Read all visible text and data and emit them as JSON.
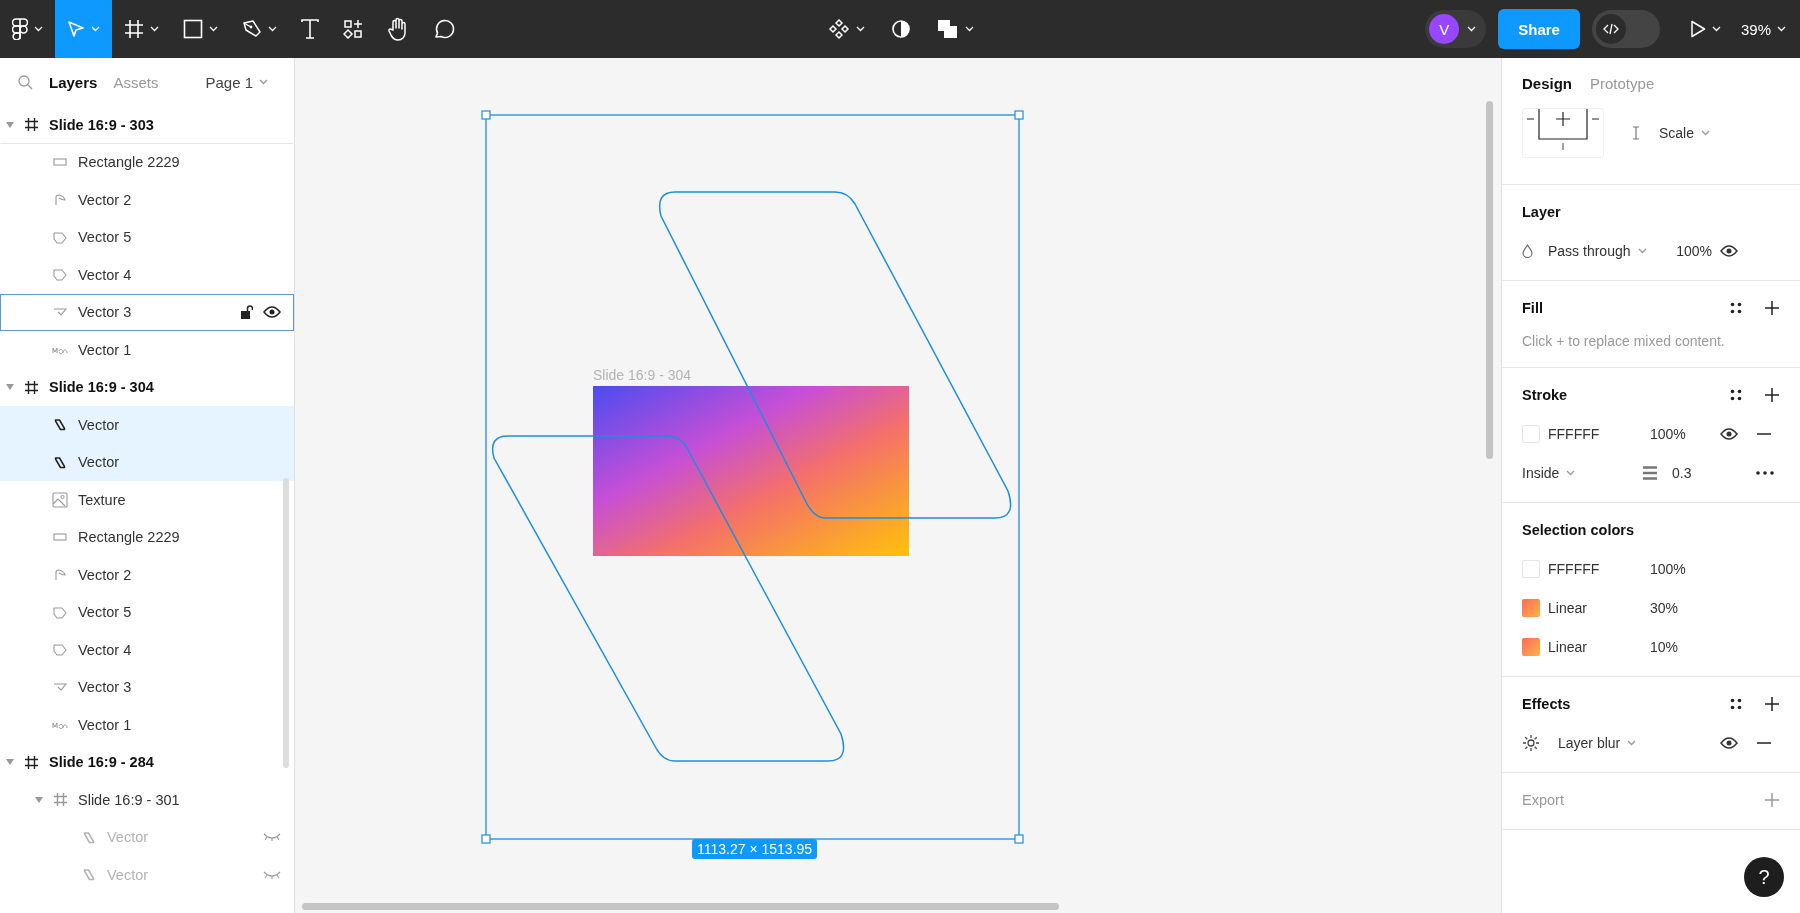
{
  "toolbar": {
    "tools": [
      {
        "kind": "main-menu",
        "selected": false
      },
      {
        "kind": "move",
        "selected": true
      },
      {
        "kind": "frame",
        "selected": false
      },
      {
        "kind": "shape",
        "selected": false
      },
      {
        "kind": "pen",
        "selected": false
      },
      {
        "kind": "text",
        "selected": false
      },
      {
        "kind": "resources",
        "selected": false
      },
      {
        "kind": "hand",
        "selected": false
      },
      {
        "kind": "comment",
        "selected": false
      }
    ],
    "center_tools": [
      {
        "kind": "components"
      },
      {
        "kind": "mask"
      },
      {
        "kind": "boolean"
      }
    ],
    "avatar": "V",
    "share": "Share",
    "dev_mode": {
      "on": false
    },
    "zoom": "39%"
  },
  "layers_panel": {
    "tabs": [
      {
        "label": "Layers",
        "selected": true
      },
      {
        "label": "Assets",
        "selected": false
      }
    ],
    "page": "Page 1",
    "layers": [
      {
        "name": "Slide 16:9 - 303",
        "kind": "frame",
        "expanded": true,
        "selected": false,
        "hovered": false,
        "hidden": false,
        "children": [
          {
            "name": "Rectangle 2229",
            "kind": "rect",
            "selected": false,
            "hovered": false,
            "hidden": false
          },
          {
            "name": "Vector 2",
            "kind": "pen",
            "selected": false,
            "hovered": false,
            "hidden": false
          },
          {
            "name": "Vector 5",
            "kind": "shape",
            "selected": false,
            "hovered": false,
            "hidden": false
          },
          {
            "name": "Vector 4",
            "kind": "shape",
            "selected": false,
            "hovered": false,
            "hidden": false
          },
          {
            "name": "Vector 3",
            "kind": "curve",
            "selected": false,
            "hovered": true,
            "hidden": false
          },
          {
            "name": "Vector 1",
            "kind": "squiggle",
            "selected": false,
            "hovered": false,
            "hidden": false
          }
        ]
      },
      {
        "name": "Slide 16:9 - 304",
        "kind": "frame",
        "expanded": true,
        "selected": false,
        "hovered": false,
        "hidden": false,
        "children": [
          {
            "name": "Vector",
            "kind": "path",
            "selected": true,
            "hovered": false,
            "hidden": false
          },
          {
            "name": "Vector",
            "kind": "path",
            "selected": true,
            "hovered": false,
            "hidden": false
          },
          {
            "name": "Texture",
            "kind": "image",
            "selected": false,
            "hovered": false,
            "hidden": false
          },
          {
            "name": "Rectangle 2229",
            "kind": "rect",
            "selected": false,
            "hovered": false,
            "hidden": false
          },
          {
            "name": "Vector 2",
            "kind": "pen",
            "selected": false,
            "hovered": false,
            "hidden": false
          },
          {
            "name": "Vector 5",
            "kind": "shape",
            "selected": false,
            "hovered": false,
            "hidden": false
          },
          {
            "name": "Vector 4",
            "kind": "shape",
            "selected": false,
            "hovered": false,
            "hidden": false
          },
          {
            "name": "Vector 3",
            "kind": "curve",
            "selected": false,
            "hovered": false,
            "hidden": false
          },
          {
            "name": "Vector 1",
            "kind": "squiggle",
            "selected": false,
            "hovered": false,
            "hidden": false
          }
        ]
      },
      {
        "name": "Slide 16:9 - 284",
        "kind": "frame",
        "expanded": true,
        "selected": false,
        "hovered": false,
        "hidden": false,
        "children": [
          {
            "name": "Slide 16:9 - 301",
            "kind": "frame",
            "expanded": true,
            "selected": false,
            "hovered": false,
            "hidden": false,
            "children": [
              {
                "name": "Vector",
                "kind": "path",
                "selected": false,
                "hovered": false,
                "hidden": true
              },
              {
                "name": "Vector",
                "kind": "path",
                "selected": false,
                "hovered": false,
                "hidden": true
              }
            ]
          }
        ]
      }
    ]
  },
  "canvas": {
    "frame_label": "Slide 16:9 - 304",
    "size_badge": "1113.27 × 1513.95"
  },
  "properties_panel": {
    "tabs": [
      {
        "label": "Design",
        "selected": true
      },
      {
        "label": "Prototype",
        "selected": false
      }
    ],
    "constraints": {
      "vertical": "Scale"
    },
    "layer": {
      "title": "Layer",
      "blend_mode": "Pass through",
      "opacity": "100%",
      "visible": true
    },
    "fill": {
      "title": "Fill",
      "hint": "Click + to replace mixed content."
    },
    "stroke": {
      "title": "Stroke",
      "hex": "FFFFFF",
      "opacity": "100%",
      "visible": true,
      "position": "Inside",
      "weight": "0.3"
    },
    "selection_colors": {
      "title": "Selection colors",
      "items": [
        {
          "kind": "solid",
          "label": "FFFFFF",
          "opacity": "100%"
        },
        {
          "kind": "gradient",
          "label": "Linear",
          "opacity": "30%"
        },
        {
          "kind": "gradient",
          "label": "Linear",
          "opacity": "10%"
        }
      ]
    },
    "effects": {
      "title": "Effects",
      "items": [
        {
          "label": "Layer blur",
          "visible": true
        }
      ]
    },
    "export": {
      "title": "Export"
    },
    "help": "?"
  }
}
